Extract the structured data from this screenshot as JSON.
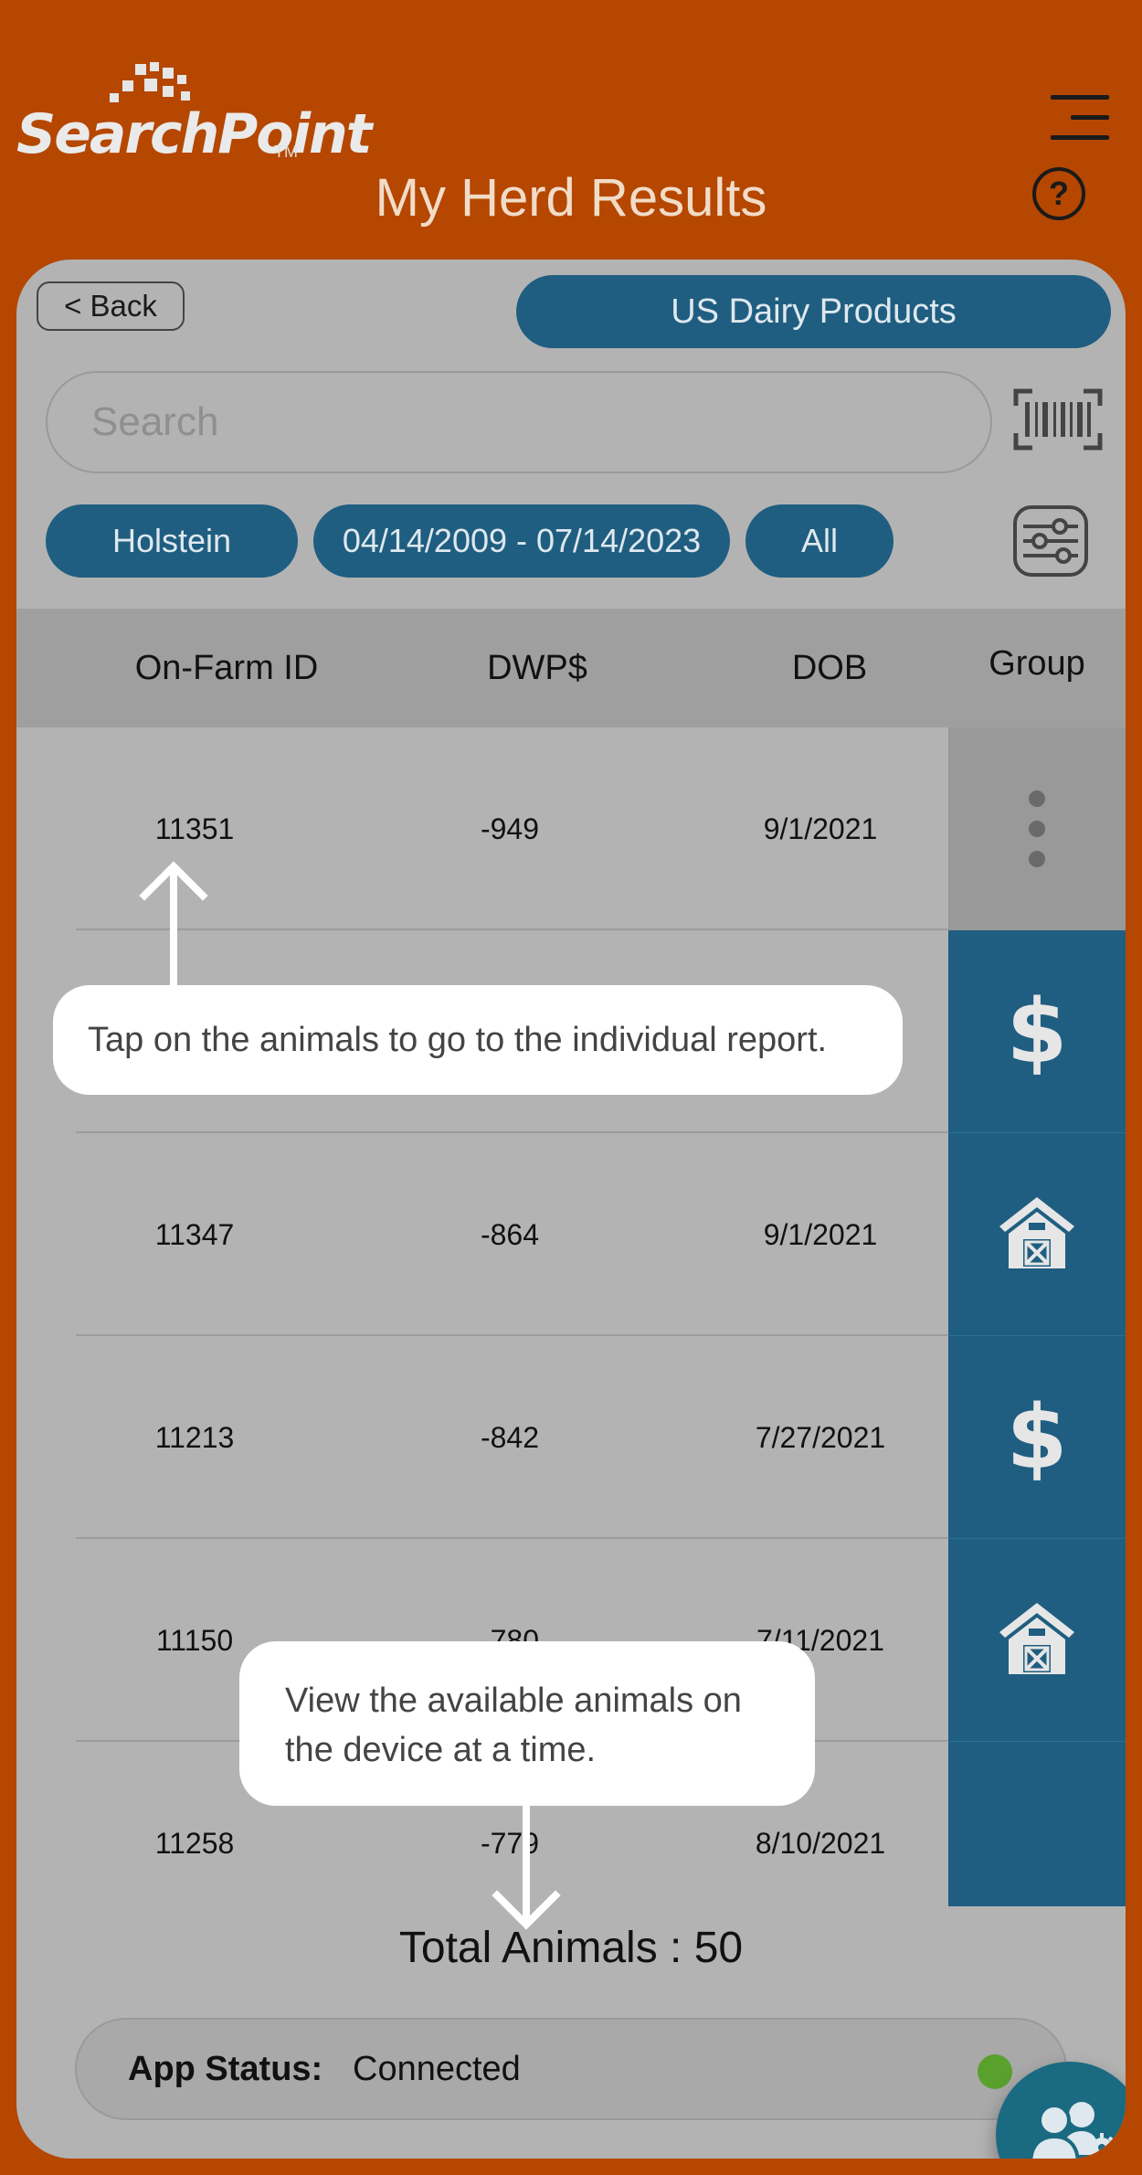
{
  "header": {
    "logo_text": "SearchPoint",
    "logo_tm": "TM",
    "title": "My Herd Results"
  },
  "toolbar": {
    "back_label": "< Back",
    "company_label": "US Dairy Products"
  },
  "search": {
    "placeholder": "Search"
  },
  "filters": {
    "breed": "Holstein",
    "date_range": "04/14/2009 - 07/14/2023",
    "group": "All"
  },
  "table": {
    "headers": [
      "On-Farm ID",
      "DWP$",
      "DOB",
      "Group"
    ],
    "rows": [
      {
        "id": "11351",
        "dwp": "-949",
        "dob": "9/1/2021",
        "group_icon": "more-vertical-icon"
      },
      {
        "id": "",
        "dwp": "",
        "dob": "",
        "group_icon": "dollar-icon"
      },
      {
        "id": "11347",
        "dwp": "-864",
        "dob": "9/1/2021",
        "group_icon": "barn-icon"
      },
      {
        "id": "11213",
        "dwp": "-842",
        "dob": "7/27/2021",
        "group_icon": "dollar-icon"
      },
      {
        "id": "11150",
        "dwp": "-780",
        "dob": "7/11/2021",
        "group_icon": "barn-icon"
      },
      {
        "id": "11258",
        "dwp": "-779",
        "dob": "8/10/2021",
        "group_icon": ""
      }
    ]
  },
  "summary": {
    "total_label": "Total Animals : 50"
  },
  "status": {
    "label": "App Status:",
    "value": "Connected",
    "color": "#5aa02c"
  },
  "tooltips": {
    "tap_animals": "Tap on the animals to go to the individual report.",
    "view_animals": "View the available animals on the device at a time."
  },
  "colors": {
    "brand_orange": "#b54700",
    "accent_blue": "#1f5e80",
    "panel_grey": "#b3b3b3"
  }
}
